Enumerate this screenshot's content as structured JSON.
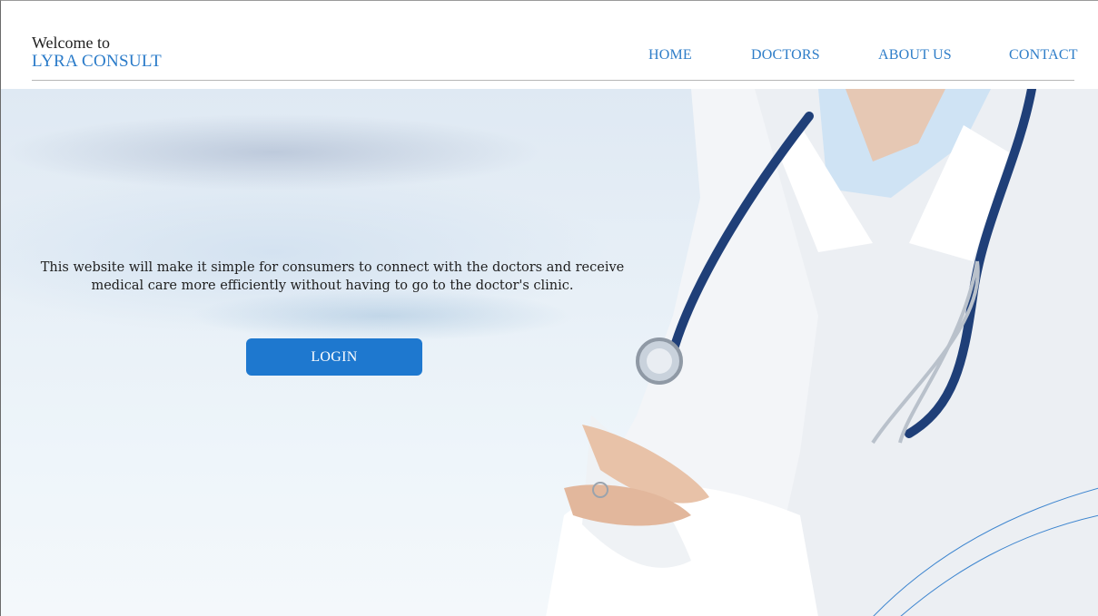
{
  "brand": {
    "welcome": "Welcome to",
    "name": "LYRA CONSULT"
  },
  "nav": {
    "items": [
      {
        "label": "HOME"
      },
      {
        "label": "DOCTORS"
      },
      {
        "label": "ABOUT US"
      },
      {
        "label": "CONTACT"
      }
    ]
  },
  "hero": {
    "description": "This website will make it simple for consumers to connect with the doctors and receive medical care more efficiently without having to go to the doctor's clinic.",
    "login_label": "LOGIN"
  },
  "colors": {
    "accent": "#2e7dc8",
    "button": "#1e78cf",
    "stethoscope": "#1f3f78"
  },
  "icons": [
    "doctor-illustration"
  ]
}
